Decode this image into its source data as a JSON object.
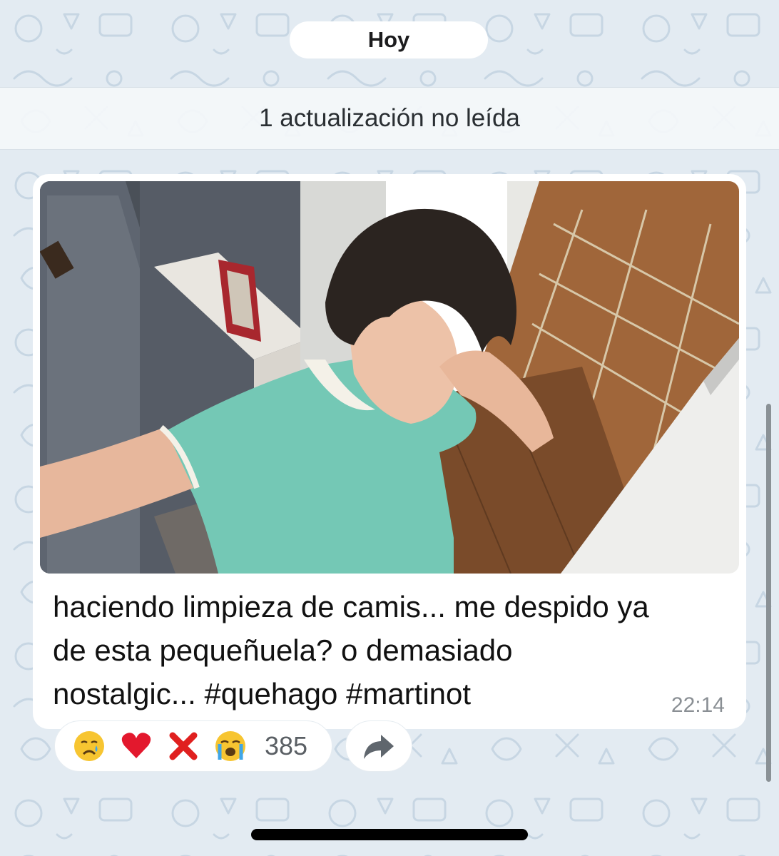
{
  "chat": {
    "date_separator": "Hoy",
    "unread_banner": "1 actualización no leída"
  },
  "message": {
    "photo_description": "selfie",
    "caption_lines": [
      "haciendo limpieza de camis... me despido ya",
      "de esta pequeñuela? o demasiado",
      "nostalgic... #quehago #martinot"
    ],
    "time": "22:14"
  },
  "reactions": {
    "items": [
      {
        "name": "crying-face-emoji"
      },
      {
        "name": "red-heart-emoji"
      },
      {
        "name": "cross-mark-emoji"
      },
      {
        "name": "loudly-crying-face-emoji"
      }
    ],
    "count": "385"
  },
  "actions": {
    "share_icon": "share-arrow-icon"
  },
  "colors": {
    "background": "#e3ebf2",
    "bubble": "#ffffff",
    "time": "#8a8f94",
    "heart": "#e3182d",
    "cross": "#e0201f"
  }
}
